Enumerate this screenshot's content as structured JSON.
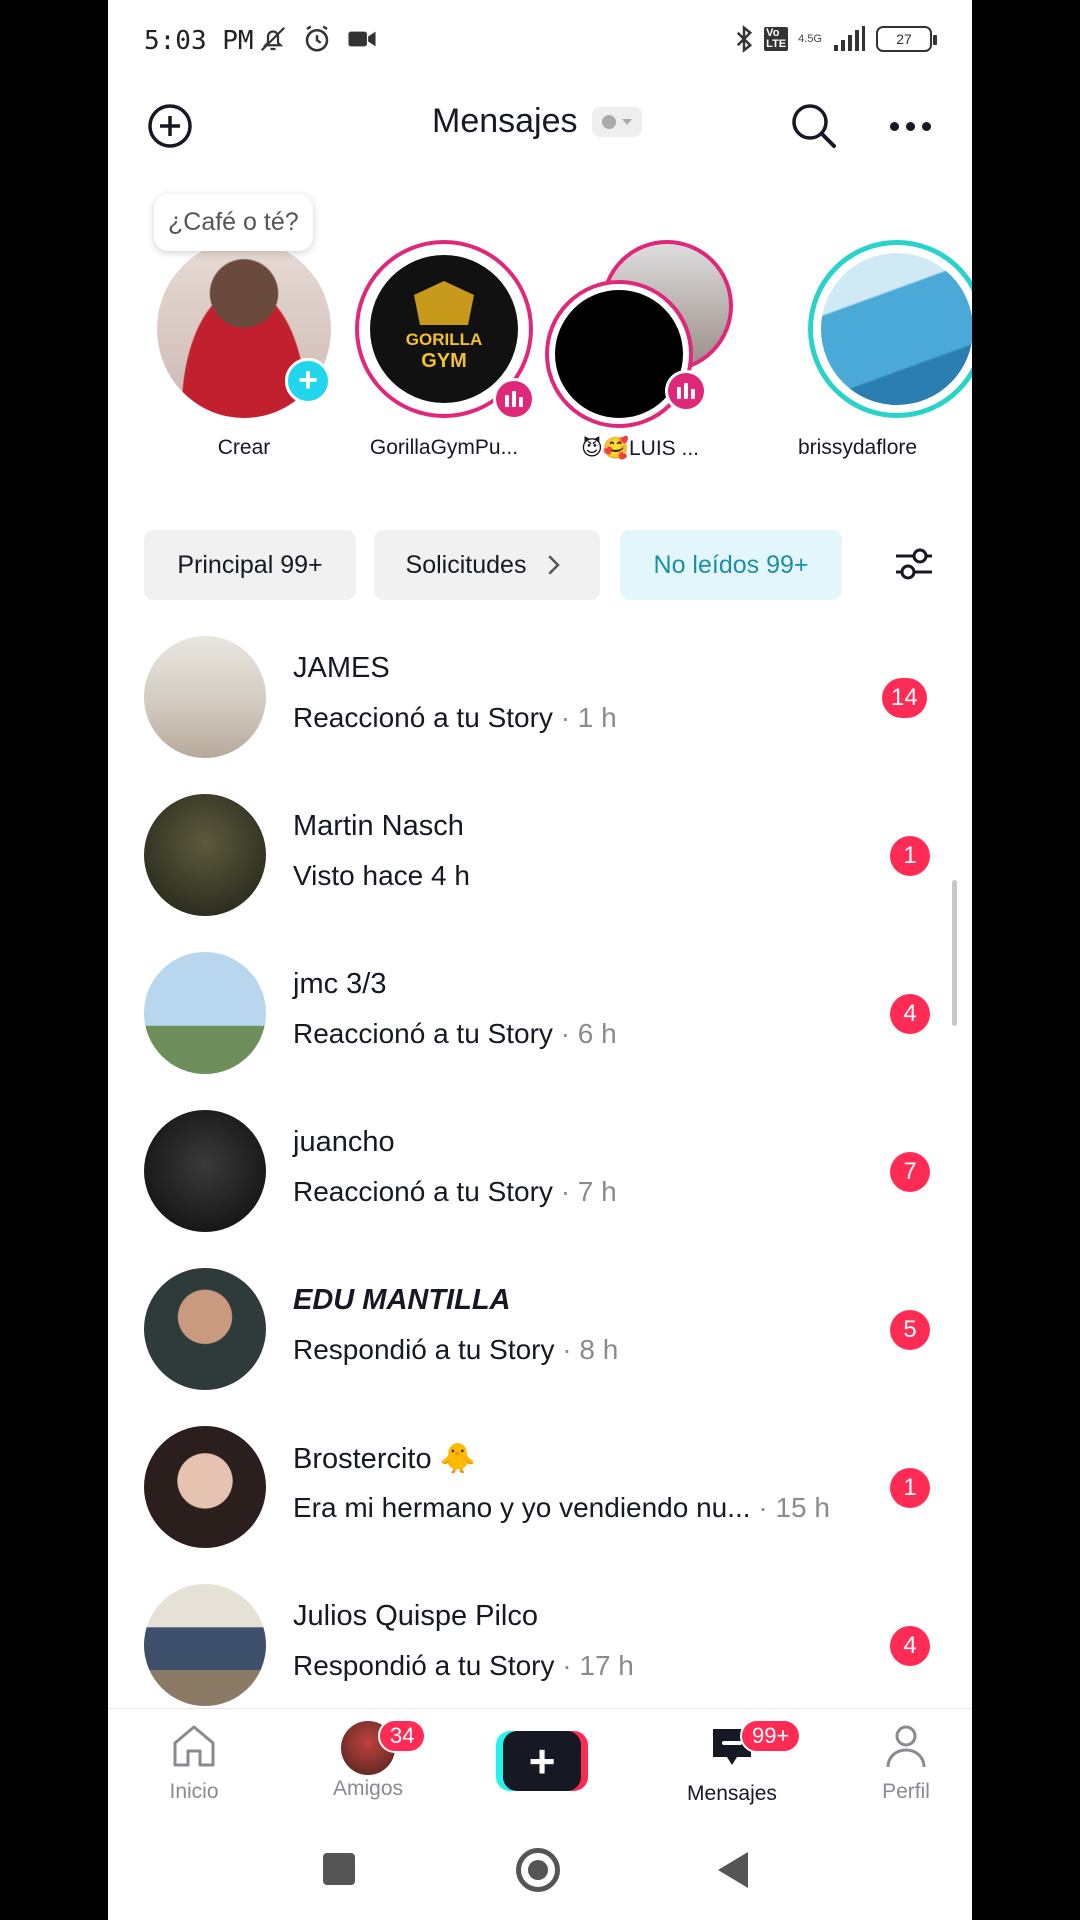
{
  "status_bar": {
    "time": "5:03 PM",
    "network": "4.5G",
    "battery": "27"
  },
  "header": {
    "title": "Mensajes",
    "icons": [
      "add-circle-icon",
      "search-icon",
      "more-icon"
    ]
  },
  "stories": {
    "bubble_text": "¿Café o té?",
    "items": [
      {
        "name": "Crear"
      },
      {
        "name": "GorillaGymPu...",
        "logo_top": "GORILLA",
        "logo_bottom": "GYM"
      },
      {
        "name": "😈🥰LUIS ..."
      },
      {
        "name": "brissydaflore"
      }
    ]
  },
  "filters": {
    "principal": "Principal 99+",
    "solicitudes": "Solicitudes",
    "no_leidos": "No leídos 99+"
  },
  "chats": [
    {
      "name": "JAMES",
      "message": "Reaccionó a tu Story",
      "time": " · 1 h",
      "unread": "14"
    },
    {
      "name": "Martin Nasch",
      "message": "Visto hace 4 h",
      "time": "",
      "unread": "1"
    },
    {
      "name": "jmc 3/3",
      "message": "Reaccionó a tu Story",
      "time": " · 6 h",
      "unread": "4"
    },
    {
      "name": "juancho",
      "message": "Reaccionó a tu Story",
      "time": " · 7 h",
      "unread": "7"
    },
    {
      "name": "EDU MANTILLA",
      "message": "Respondió a tu Story",
      "time": " · 8 h",
      "unread": "5"
    },
    {
      "name": "Brostercito 🐥",
      "message": "Era mi hermano y yo vendiendo nu...",
      "time": " · 15 h",
      "unread": "1"
    },
    {
      "name": "Julios Quispe Pilco",
      "message": "Respondió a tu Story",
      "time": " · 17 h",
      "unread": "4"
    }
  ],
  "bottom_nav": {
    "inicio": "Inicio",
    "amigos": "Amigos",
    "amigos_count": "34",
    "mensajes": "Mensajes",
    "mensajes_count": "99+",
    "perfil": "Perfil"
  },
  "colors": {
    "accent_red": "#fe2c55",
    "live_ring": "#e0287b",
    "active_chip_bg": "#e3f6fb",
    "active_chip_text": "#1a8fa6"
  }
}
